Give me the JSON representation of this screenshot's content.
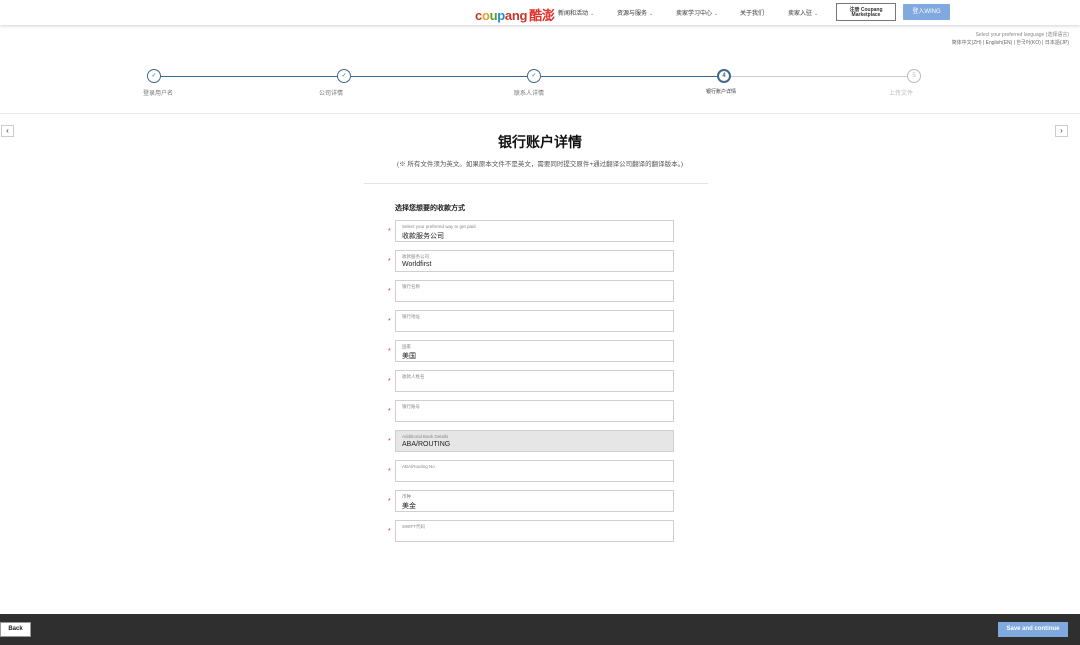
{
  "header": {
    "logo": {
      "c": "c",
      "o": "o",
      "u": "u",
      "p": "p",
      "ang": "ang",
      "cn": "酷澎"
    },
    "nav": [
      {
        "label": "新闻和活动",
        "has_dropdown": true
      },
      {
        "label": "资源与服务",
        "has_dropdown": true
      },
      {
        "label": "卖家学习中心",
        "has_dropdown": true
      },
      {
        "label": "关于我们",
        "has_dropdown": false
      },
      {
        "label": "卖家入驻",
        "has_dropdown": true
      }
    ],
    "register_button": "注册 Coupang Marketplace",
    "login_button": "登入WING",
    "language_label": "Select your preferred language (选择语言)",
    "languages": "简体中文(ZH) | English(EN) | 한국어(KO) | 日本語(JP)"
  },
  "stepper": {
    "steps": [
      {
        "number": "✓",
        "label": "登录用户名",
        "state": "done"
      },
      {
        "number": "✓",
        "label": "公司详情",
        "state": "done"
      },
      {
        "number": "✓",
        "label": "联系人详情",
        "state": "done"
      },
      {
        "number": "4",
        "label": "银行账户详情",
        "state": "current"
      },
      {
        "number": "5",
        "label": "上传文件",
        "state": "todo"
      }
    ]
  },
  "nav_arrows": {
    "prev": "‹",
    "next": "›"
  },
  "main": {
    "title": "银行账户详情",
    "note": "(※ 所有文件须为英文。如果原本文件不是英文，需要同时提交原件+通过翻译公司翻译的翻译版本。)",
    "section_title": "选择您想要的收款方式",
    "required_mark": "*",
    "fields": [
      {
        "label": "Select your preferred way to get paid",
        "value": "收款服务公司",
        "disabled": false
      },
      {
        "label": "收款服务公司",
        "value": "Worldfirst",
        "disabled": false
      },
      {
        "label": "银行名称",
        "value": "",
        "disabled": false
      },
      {
        "label": "银行地址",
        "value": "",
        "disabled": false
      },
      {
        "label": "国家",
        "value": "美国",
        "disabled": false
      },
      {
        "label": "收款人姓名",
        "value": "",
        "disabled": false
      },
      {
        "label": "银行账号",
        "value": "",
        "disabled": false
      },
      {
        "label": "Additional Bank Details",
        "value": "ABA/ROUTING",
        "disabled": true
      },
      {
        "label": "ABA/Routing No",
        "value": "",
        "disabled": false
      },
      {
        "label": "币种",
        "value": "美金",
        "disabled": false
      },
      {
        "label": "SWIFT代码",
        "value": "",
        "disabled": false
      }
    ]
  },
  "footer": {
    "back_button": "Back",
    "save_button": "Save and continue"
  },
  "colors": {
    "accent_blue": "#7fa9df",
    "stepper_blue": "#3d6b8c",
    "footer_bg": "#2f2f2f",
    "required_red": "#dd3333"
  }
}
